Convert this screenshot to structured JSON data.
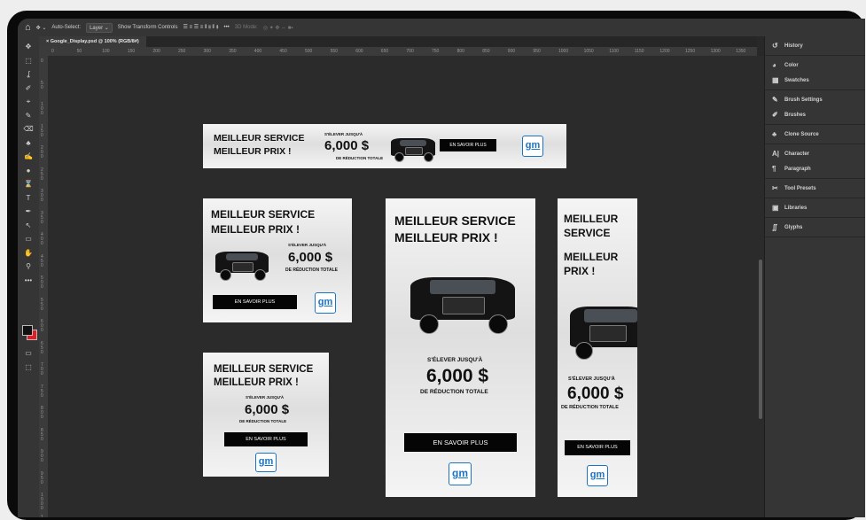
{
  "options_bar": {
    "move_tool": "✥ ⌄",
    "auto_select_label": "Auto-Select:",
    "layer_dropdown": "Layer ⌄",
    "transform_label": "Show Transform Controls",
    "align_icons": "☰ ≡ ☰ ≡   ⫴ ⫵ ⫴ ⫵",
    "more": "•••",
    "mode_3d": "3D Mode:",
    "mode_3d_icons": "◎ ✦ ✥ ⇔ ■▪"
  },
  "document_tab": {
    "title": "Google_Display.psd @ 100% (RGB/8#)"
  },
  "ruler": {
    "h_ticks": [
      "0",
      "50",
      "100",
      "150",
      "200",
      "250",
      "300",
      "350",
      "400",
      "450",
      "500",
      "550",
      "600",
      "650",
      "700",
      "750",
      "800",
      "850",
      "900",
      "950",
      "1000",
      "1050",
      "1100",
      "1150",
      "1200",
      "1250",
      "1300",
      "1350"
    ],
    "v_ticks": [
      "0",
      "5\n0",
      "1\n0\n0",
      "1\n5\n0",
      "2\n0\n0",
      "2\n5\n0",
      "3\n0\n0",
      "3\n5\n0",
      "4\n0\n0",
      "4\n5\n0",
      "5\n0\n0",
      "5\n5\n0",
      "6\n0\n0",
      "6\n5\n0",
      "7\n0\n0",
      "7\n5\n0",
      "8\n0\n0",
      "8\n5\n0",
      "9\n0\n0",
      "9\n5\n0",
      "1\n0\n0\n0",
      "1\n0\n5\n0"
    ]
  },
  "tools": [
    "✥",
    "⬚",
    "ʆ",
    "✐",
    "⌖",
    "✎",
    "⌫",
    "♣",
    "✍",
    "●",
    "⌛",
    "T",
    "✒",
    "↖",
    "▭",
    "✋",
    "⚲",
    "•••"
  ],
  "panels": {
    "group1": [
      {
        "icon": "↺",
        "label": "History"
      }
    ],
    "group2": [
      {
        "icon": "◕",
        "label": "Color"
      },
      {
        "icon": "▦",
        "label": "Swatches"
      }
    ],
    "group3": [
      {
        "icon": "✎",
        "label": "Brush Settings"
      },
      {
        "icon": "✐",
        "label": "Brushes"
      }
    ],
    "group4": [
      {
        "icon": "♣",
        "label": "Clone Source"
      }
    ],
    "group5": [
      {
        "icon": "A|",
        "label": "Character"
      },
      {
        "icon": "¶",
        "label": "Paragraph"
      }
    ],
    "group6": [
      {
        "icon": "✂",
        "label": "Tool Presets"
      }
    ],
    "group7": [
      {
        "icon": "▣",
        "label": "Libraries"
      }
    ],
    "group8": [
      {
        "icon": "∬",
        "label": "Glyphs"
      }
    ]
  },
  "ad": {
    "headline": "MEILLEUR SERVICE MEILLEUR PRIX !",
    "headline_line1": "MEILLEUR SERVICE",
    "headline_line2": "MEILLEUR PRIX !",
    "sky_line1": "MEILLEUR",
    "sky_line2": "SERVICE",
    "sky_line3": "MEILLEUR",
    "sky_line4": "PRIX !",
    "upto": "S'ÉLEVER JUSQU'À",
    "amount": "6,000 $",
    "discount": "DE RÉDUCTION TOTALE",
    "cta": "EN SAVOIR PLUS",
    "logo": "gm",
    "colors": {
      "cta_bg": "#050505",
      "logo_blue": "#1b73c4",
      "bg": "#f4f4f4"
    }
  }
}
